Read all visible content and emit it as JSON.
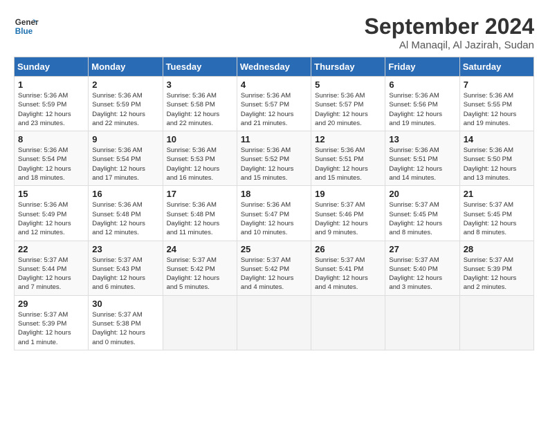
{
  "logo": {
    "line1": "General",
    "line2": "Blue"
  },
  "title": "September 2024",
  "subtitle": "Al Manaqil, Al Jazirah, Sudan",
  "headers": [
    "Sunday",
    "Monday",
    "Tuesday",
    "Wednesday",
    "Thursday",
    "Friday",
    "Saturday"
  ],
  "weeks": [
    [
      {
        "day": "1",
        "detail": "Sunrise: 5:36 AM\nSunset: 5:59 PM\nDaylight: 12 hours\nand 23 minutes."
      },
      {
        "day": "2",
        "detail": "Sunrise: 5:36 AM\nSunset: 5:59 PM\nDaylight: 12 hours\nand 22 minutes."
      },
      {
        "day": "3",
        "detail": "Sunrise: 5:36 AM\nSunset: 5:58 PM\nDaylight: 12 hours\nand 22 minutes."
      },
      {
        "day": "4",
        "detail": "Sunrise: 5:36 AM\nSunset: 5:57 PM\nDaylight: 12 hours\nand 21 minutes."
      },
      {
        "day": "5",
        "detail": "Sunrise: 5:36 AM\nSunset: 5:57 PM\nDaylight: 12 hours\nand 20 minutes."
      },
      {
        "day": "6",
        "detail": "Sunrise: 5:36 AM\nSunset: 5:56 PM\nDaylight: 12 hours\nand 19 minutes."
      },
      {
        "day": "7",
        "detail": "Sunrise: 5:36 AM\nSunset: 5:55 PM\nDaylight: 12 hours\nand 19 minutes."
      }
    ],
    [
      {
        "day": "8",
        "detail": "Sunrise: 5:36 AM\nSunset: 5:54 PM\nDaylight: 12 hours\nand 18 minutes."
      },
      {
        "day": "9",
        "detail": "Sunrise: 5:36 AM\nSunset: 5:54 PM\nDaylight: 12 hours\nand 17 minutes."
      },
      {
        "day": "10",
        "detail": "Sunrise: 5:36 AM\nSunset: 5:53 PM\nDaylight: 12 hours\nand 16 minutes."
      },
      {
        "day": "11",
        "detail": "Sunrise: 5:36 AM\nSunset: 5:52 PM\nDaylight: 12 hours\nand 15 minutes."
      },
      {
        "day": "12",
        "detail": "Sunrise: 5:36 AM\nSunset: 5:51 PM\nDaylight: 12 hours\nand 15 minutes."
      },
      {
        "day": "13",
        "detail": "Sunrise: 5:36 AM\nSunset: 5:51 PM\nDaylight: 12 hours\nand 14 minutes."
      },
      {
        "day": "14",
        "detail": "Sunrise: 5:36 AM\nSunset: 5:50 PM\nDaylight: 12 hours\nand 13 minutes."
      }
    ],
    [
      {
        "day": "15",
        "detail": "Sunrise: 5:36 AM\nSunset: 5:49 PM\nDaylight: 12 hours\nand 12 minutes."
      },
      {
        "day": "16",
        "detail": "Sunrise: 5:36 AM\nSunset: 5:48 PM\nDaylight: 12 hours\nand 12 minutes."
      },
      {
        "day": "17",
        "detail": "Sunrise: 5:36 AM\nSunset: 5:48 PM\nDaylight: 12 hours\nand 11 minutes."
      },
      {
        "day": "18",
        "detail": "Sunrise: 5:36 AM\nSunset: 5:47 PM\nDaylight: 12 hours\nand 10 minutes."
      },
      {
        "day": "19",
        "detail": "Sunrise: 5:37 AM\nSunset: 5:46 PM\nDaylight: 12 hours\nand 9 minutes."
      },
      {
        "day": "20",
        "detail": "Sunrise: 5:37 AM\nSunset: 5:45 PM\nDaylight: 12 hours\nand 8 minutes."
      },
      {
        "day": "21",
        "detail": "Sunrise: 5:37 AM\nSunset: 5:45 PM\nDaylight: 12 hours\nand 8 minutes."
      }
    ],
    [
      {
        "day": "22",
        "detail": "Sunrise: 5:37 AM\nSunset: 5:44 PM\nDaylight: 12 hours\nand 7 minutes."
      },
      {
        "day": "23",
        "detail": "Sunrise: 5:37 AM\nSunset: 5:43 PM\nDaylight: 12 hours\nand 6 minutes."
      },
      {
        "day": "24",
        "detail": "Sunrise: 5:37 AM\nSunset: 5:42 PM\nDaylight: 12 hours\nand 5 minutes."
      },
      {
        "day": "25",
        "detail": "Sunrise: 5:37 AM\nSunset: 5:42 PM\nDaylight: 12 hours\nand 4 minutes."
      },
      {
        "day": "26",
        "detail": "Sunrise: 5:37 AM\nSunset: 5:41 PM\nDaylight: 12 hours\nand 4 minutes."
      },
      {
        "day": "27",
        "detail": "Sunrise: 5:37 AM\nSunset: 5:40 PM\nDaylight: 12 hours\nand 3 minutes."
      },
      {
        "day": "28",
        "detail": "Sunrise: 5:37 AM\nSunset: 5:39 PM\nDaylight: 12 hours\nand 2 minutes."
      }
    ],
    [
      {
        "day": "29",
        "detail": "Sunrise: 5:37 AM\nSunset: 5:39 PM\nDaylight: 12 hours\nand 1 minute."
      },
      {
        "day": "30",
        "detail": "Sunrise: 5:37 AM\nSunset: 5:38 PM\nDaylight: 12 hours\nand 0 minutes."
      },
      null,
      null,
      null,
      null,
      null
    ]
  ]
}
